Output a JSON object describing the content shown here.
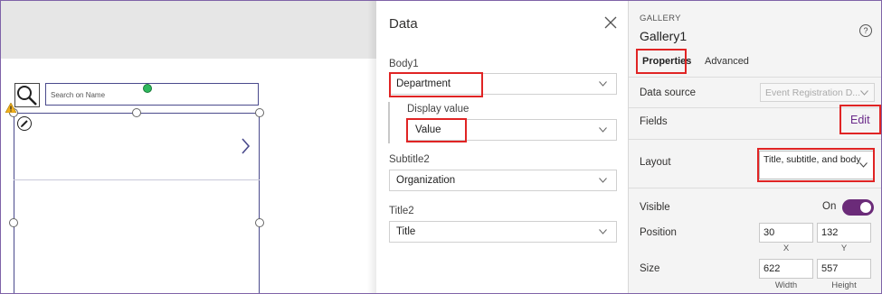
{
  "canvas": {
    "search_placeholder": "Search on Name"
  },
  "data_panel": {
    "title": "Data",
    "fields": [
      {
        "label": "Body1",
        "value": "Department"
      },
      {
        "label": "Display value",
        "value": "Value"
      },
      {
        "label": "Subtitle2",
        "value": "Organization"
      },
      {
        "label": "Title2",
        "value": "Title"
      }
    ]
  },
  "properties": {
    "caption": "GALLERY",
    "name": "Gallery1",
    "help": "?",
    "tabs": [
      "Properties",
      "Advanced"
    ],
    "data_source_label": "Data source",
    "data_source_value": "Event Registration D...",
    "fields_label": "Fields",
    "edit_label": "Edit",
    "layout_label": "Layout",
    "layout_value": "Title, subtitle, and body",
    "visible_label": "Visible",
    "visible_state": "On",
    "position_label": "Position",
    "position_x": "30",
    "position_y": "132",
    "x_cap": "X",
    "y_cap": "Y",
    "size_label": "Size",
    "size_width": "622",
    "size_height": "557",
    "width_cap": "Width",
    "height_cap": "Height"
  },
  "colors": {
    "accent": "#6b2b79",
    "highlight": "#e02424",
    "frame": "#7f63a8"
  }
}
